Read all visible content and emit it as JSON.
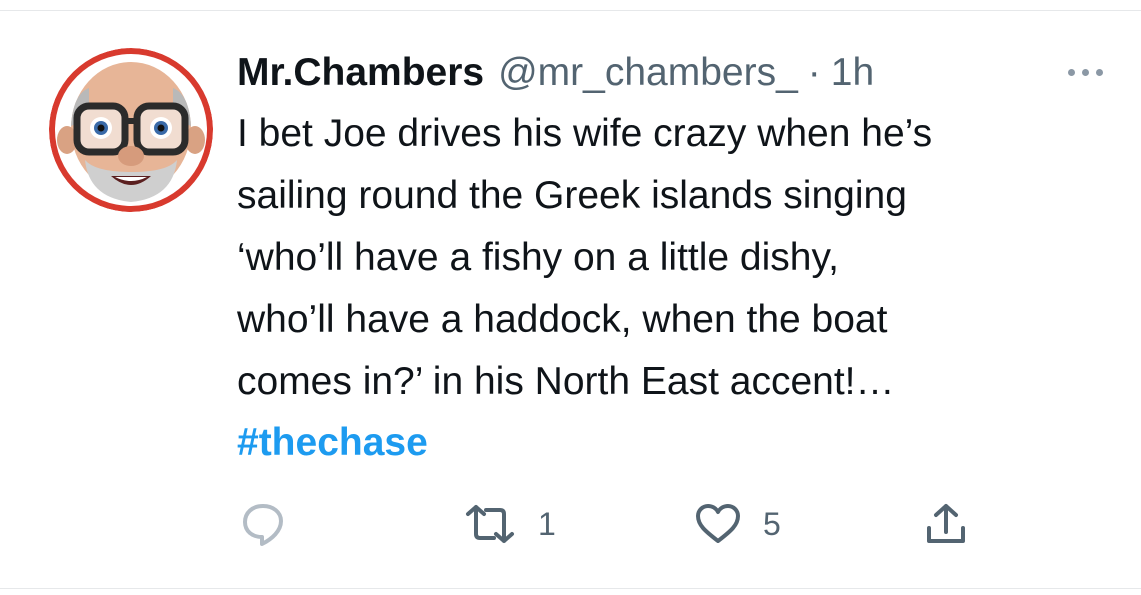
{
  "tweet": {
    "display_name": "Mr.Chambers",
    "handle": "@mr_chambers_",
    "separator": "·",
    "time": "1h",
    "text_lines": [
      "I bet Joe drives his wife crazy when he’s",
      "sailing round the Greek islands singing",
      "‘who’ll have a fishy on a little dishy,",
      "who’ll have a haddock, when the boat",
      "comes in?’ in his North East accent!…"
    ],
    "hashtag": "#thechase"
  },
  "actions": {
    "reply_count": "",
    "retweet_count": "1",
    "like_count": "5"
  },
  "icons": {
    "more": "more-icon",
    "reply": "reply-icon",
    "retweet": "retweet-icon",
    "like": "heart-icon",
    "share": "share-icon"
  },
  "colors": {
    "link": "#1d9bf0",
    "secondary_text": "#536471",
    "primary_text": "#0f1419",
    "avatar_ring": "#d83a2e"
  }
}
